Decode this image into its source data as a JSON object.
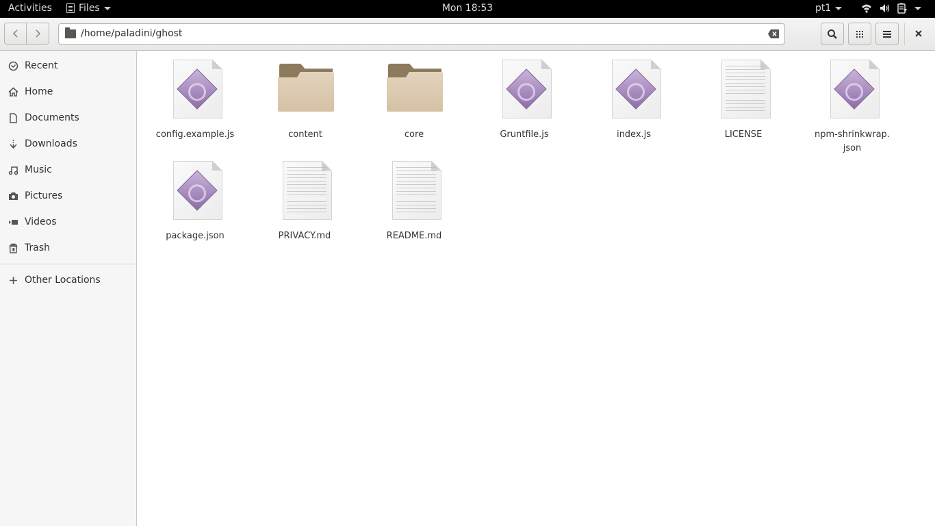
{
  "topbar": {
    "activities": "Activities",
    "app_menu": "Files",
    "clock": "Mon 18:53",
    "input_source": "pt1",
    "tray_icons": [
      "wifi-icon",
      "volume-icon",
      "battery-icon",
      "system-menu-caret-icon"
    ]
  },
  "headerbar": {
    "back_icon": "chevron-left-icon",
    "forward_icon": "chevron-right-icon",
    "path": "/home/paladini/ghost",
    "search_icon": "search-icon",
    "view_icon": "grid-view-icon",
    "menu_icon": "hamburger-menu-icon",
    "close_icon": "close-icon"
  },
  "sidebar": {
    "items": [
      {
        "label": "Recent",
        "icon": "clock-icon"
      },
      {
        "label": "Home",
        "icon": "home-icon"
      },
      {
        "label": "Documents",
        "icon": "document-icon"
      },
      {
        "label": "Downloads",
        "icon": "download-icon"
      },
      {
        "label": "Music",
        "icon": "music-icon"
      },
      {
        "label": "Pictures",
        "icon": "camera-icon"
      },
      {
        "label": "Videos",
        "icon": "video-icon"
      },
      {
        "label": "Trash",
        "icon": "trash-icon"
      }
    ],
    "other_locations": {
      "label": "Other Locations",
      "icon": "plus-icon"
    }
  },
  "files": [
    {
      "name": "config.example.js",
      "type": "script"
    },
    {
      "name": "content",
      "type": "folder"
    },
    {
      "name": "core",
      "type": "folder"
    },
    {
      "name": "Gruntfile.js",
      "type": "script"
    },
    {
      "name": "index.js",
      "type": "script"
    },
    {
      "name": "LICENSE",
      "type": "text"
    },
    {
      "name": "npm-shrinkwrap.\njson",
      "type": "script"
    },
    {
      "name": "package.json",
      "type": "script"
    },
    {
      "name": "PRIVACY.md",
      "type": "text"
    },
    {
      "name": "README.md",
      "type": "text"
    }
  ]
}
